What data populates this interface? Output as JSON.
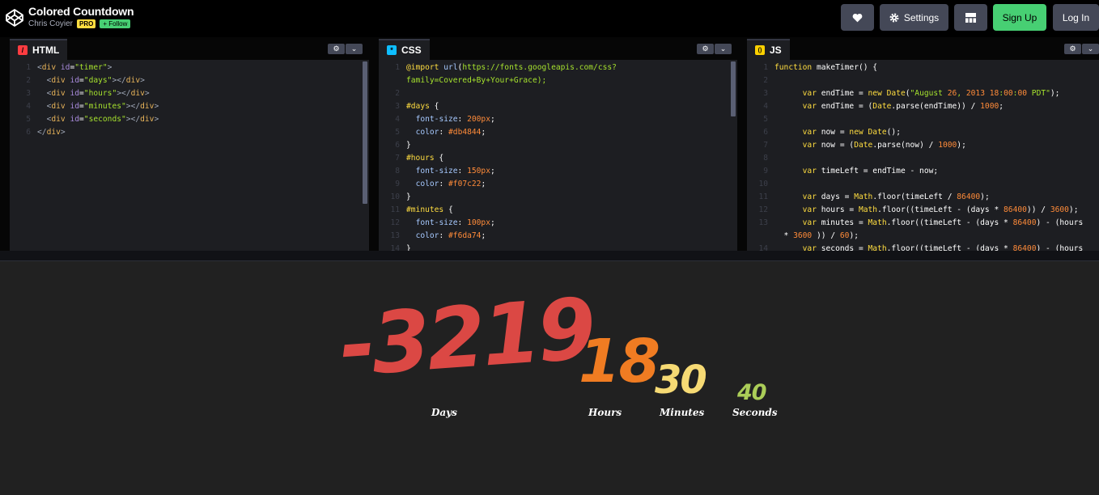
{
  "header": {
    "pen_title": "Colored Countdown",
    "author": "Chris Coyier",
    "pro_badge": "PRO",
    "follow_label": "+ Follow",
    "settings_label": "Settings",
    "signup_label": "Sign Up",
    "login_label": "Log In"
  },
  "editors": {
    "html": {
      "label": "HTML",
      "icon": "/",
      "lines": [
        {
          "n": "1",
          "text": "<div id=\"timer\">"
        },
        {
          "n": "2",
          "text": "  <div id=\"days\"></div>"
        },
        {
          "n": "3",
          "text": "  <div id=\"hours\"></div>"
        },
        {
          "n": "4",
          "text": "  <div id=\"minutes\"></div>"
        },
        {
          "n": "5",
          "text": "  <div id=\"seconds\"></div>"
        },
        {
          "n": "6",
          "text": "</div>"
        }
      ]
    },
    "css": {
      "label": "CSS",
      "icon": "*",
      "lines": [
        {
          "n": "1",
          "text": "@import url(https://fonts.googleapis.com/css?"
        },
        {
          "n": "",
          "text": "family=Covered+By+Your+Grace);"
        },
        {
          "n": "2",
          "text": ""
        },
        {
          "n": "3",
          "text": "#days {"
        },
        {
          "n": "4",
          "text": "  font-size: 200px;"
        },
        {
          "n": "5",
          "text": "  color: #db4844;"
        },
        {
          "n": "6",
          "text": "}"
        },
        {
          "n": "7",
          "text": "#hours {"
        },
        {
          "n": "8",
          "text": "  font-size: 150px;"
        },
        {
          "n": "9",
          "text": "  color: #f07c22;"
        },
        {
          "n": "10",
          "text": "}"
        },
        {
          "n": "11",
          "text": "#minutes {"
        },
        {
          "n": "12",
          "text": "  font-size: 100px;"
        },
        {
          "n": "13",
          "text": "  color: #f6da74;"
        },
        {
          "n": "14",
          "text": "}"
        }
      ]
    },
    "js": {
      "label": "JS",
      "icon": "()",
      "lines": [
        {
          "n": "1",
          "text": "function makeTimer() {"
        },
        {
          "n": "2",
          "text": ""
        },
        {
          "n": "3",
          "text": "      var endTime = new Date(\"August 26, 2013 18:00:00 PDT\");"
        },
        {
          "n": "4",
          "text": "      var endTime = (Date.parse(endTime)) / 1000;"
        },
        {
          "n": "5",
          "text": ""
        },
        {
          "n": "6",
          "text": "      var now = new Date();"
        },
        {
          "n": "7",
          "text": "      var now = (Date.parse(now) / 1000);"
        },
        {
          "n": "8",
          "text": ""
        },
        {
          "n": "9",
          "text": "      var timeLeft = endTime - now;"
        },
        {
          "n": "10",
          "text": ""
        },
        {
          "n": "11",
          "text": "      var days = Math.floor(timeLeft / 86400);"
        },
        {
          "n": "12",
          "text": "      var hours = Math.floor((timeLeft - (days * 86400)) / 3600);"
        },
        {
          "n": "13",
          "text": "      var minutes = Math.floor((timeLeft - (days * 86400) - (hours"
        },
        {
          "n": "",
          "text": "  * 3600 )) / 60);"
        },
        {
          "n": "14",
          "text": "      var seconds = Math.floor((timeLeft - (days * 86400) - (hours"
        }
      ]
    }
  },
  "preview": {
    "days_value": "-3219",
    "days_label": "Days",
    "hours_value": "18",
    "hours_label": "Hours",
    "minutes_value": "30",
    "minutes_label": "Minutes",
    "seconds_value": "40",
    "seconds_label": "Seconds",
    "colors": {
      "days": "#db4844",
      "hours": "#f07c22",
      "minutes": "#f6da74",
      "seconds": "#abcd58"
    }
  },
  "icons": {
    "logo": "codepen-logo-icon",
    "heart": "heart-icon",
    "settings": "gear-icon",
    "layout": "layout-grid-icon"
  }
}
